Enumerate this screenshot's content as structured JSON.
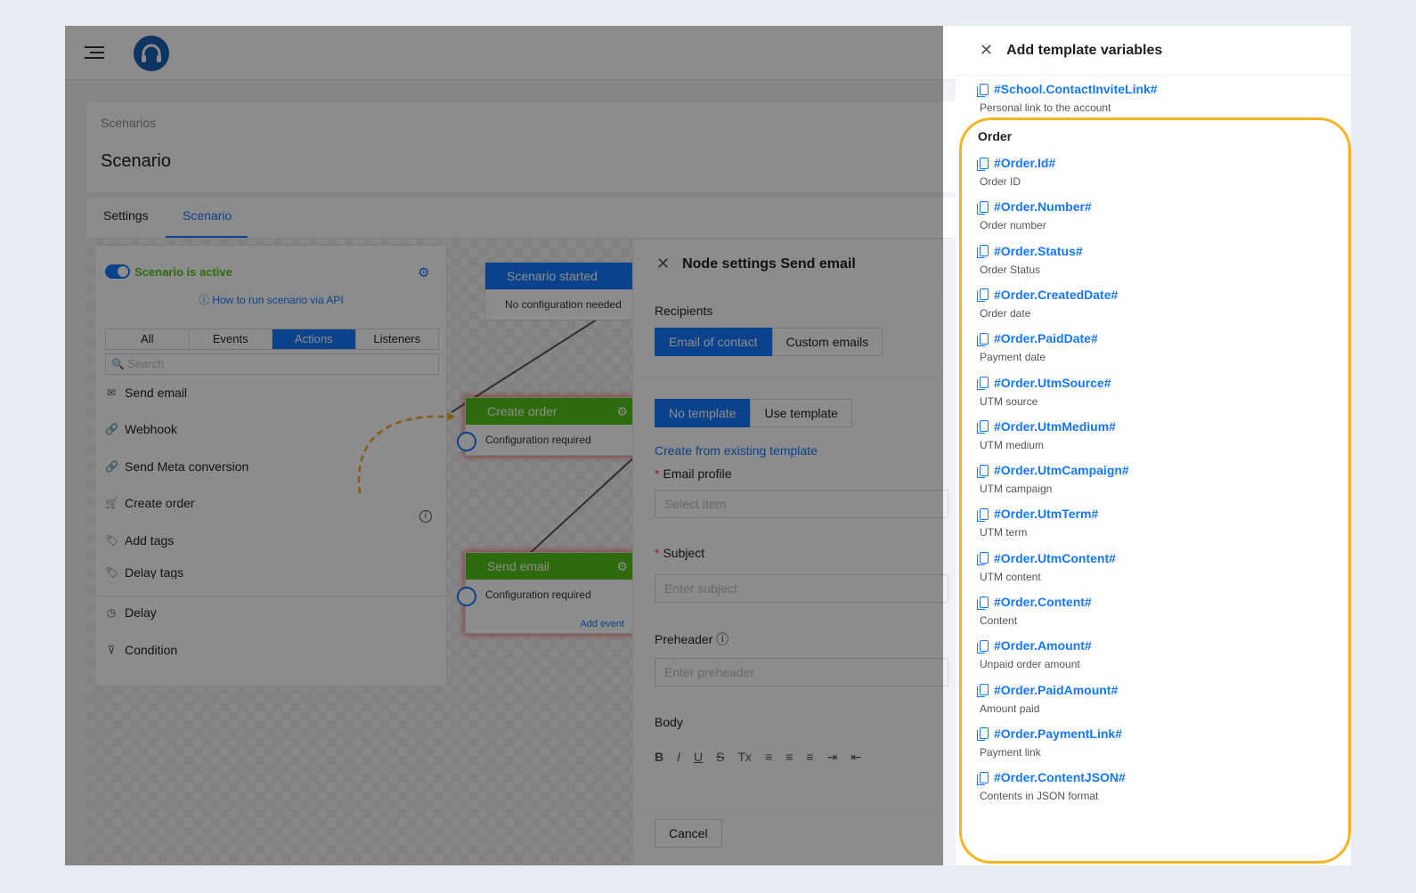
{
  "header": {
    "logo": "headset-icon"
  },
  "breadcrumb": "Scenarios",
  "page_title": "Scenario",
  "tabs": [
    {
      "label": "Settings"
    },
    {
      "label": "Scenario"
    }
  ],
  "sidepanel": {
    "status_label": "Scenario is active",
    "api_link": "How to run scenario via API",
    "filters": [
      "All",
      "Events",
      "Actions",
      "Listeners"
    ],
    "search_placeholder": "Search",
    "actions": [
      "Send email",
      "Webhook",
      "Send Meta conversion",
      "Create order",
      "Add tags",
      "Delay tags"
    ],
    "bottom_actions": [
      "Delay",
      "Condition"
    ]
  },
  "nodes": {
    "started": {
      "title": "Scenario started",
      "body": "No configuration needed"
    },
    "create_order": {
      "title": "Create order",
      "body": "Configuration required"
    },
    "send_email": {
      "title": "Send email",
      "body": "Configuration required",
      "add_event": "Add event"
    }
  },
  "drawer": {
    "title": "Node settings Send email",
    "recipients_label": "Recipients",
    "recipients_options": [
      "Email of contact",
      "Custom emails"
    ],
    "template_options": [
      "No template",
      "Use template"
    ],
    "create_link": "Create from existing template",
    "email_profile_label": "Email profile",
    "email_profile_placeholder": "Select item",
    "subject_label": "Subject",
    "subject_placeholder": "Enter subject",
    "preheader_label": "Preheader",
    "preheader_placeholder": "Enter preheader",
    "body_label": "Body",
    "toolbar": [
      "B",
      "I",
      "U",
      "S",
      "Tx",
      "≡",
      "≡",
      "≡",
      "⇥",
      "⇤"
    ],
    "cancel": "Cancel"
  },
  "variables_panel": {
    "title": "Add template variables",
    "top_item": {
      "code": "#School.ContactInviteLink#",
      "desc": "Personal link to the account"
    },
    "section": "Order",
    "items": [
      {
        "code": "#Order.Id#",
        "desc": "Order ID"
      },
      {
        "code": "#Order.Number#",
        "desc": "Order number"
      },
      {
        "code": "#Order.Status#",
        "desc": "Order Status"
      },
      {
        "code": "#Order.CreatedDate#",
        "desc": "Order date"
      },
      {
        "code": "#Order.PaidDate#",
        "desc": "Payment date"
      },
      {
        "code": "#Order.UtmSource#",
        "desc": "UTM source"
      },
      {
        "code": "#Order.UtmMedium#",
        "desc": "UTM medium"
      },
      {
        "code": "#Order.UtmCampaign#",
        "desc": "UTM campaign"
      },
      {
        "code": "#Order.UtmTerm#",
        "desc": "UTM term"
      },
      {
        "code": "#Order.UtmContent#",
        "desc": "UTM content"
      },
      {
        "code": "#Order.Content#",
        "desc": "Content"
      },
      {
        "code": "#Order.Amount#",
        "desc": "Unpaid order amount"
      },
      {
        "code": "#Order.PaidAmount#",
        "desc": "Amount paid"
      },
      {
        "code": "#Order.PaymentLink#",
        "desc": "Payment link"
      },
      {
        "code": "#Order.ContentJSON#",
        "desc": "Contents in JSON format"
      }
    ]
  },
  "colors": {
    "primary": "#1677ff",
    "success": "#52c41a",
    "highlight": "#f5b422"
  }
}
